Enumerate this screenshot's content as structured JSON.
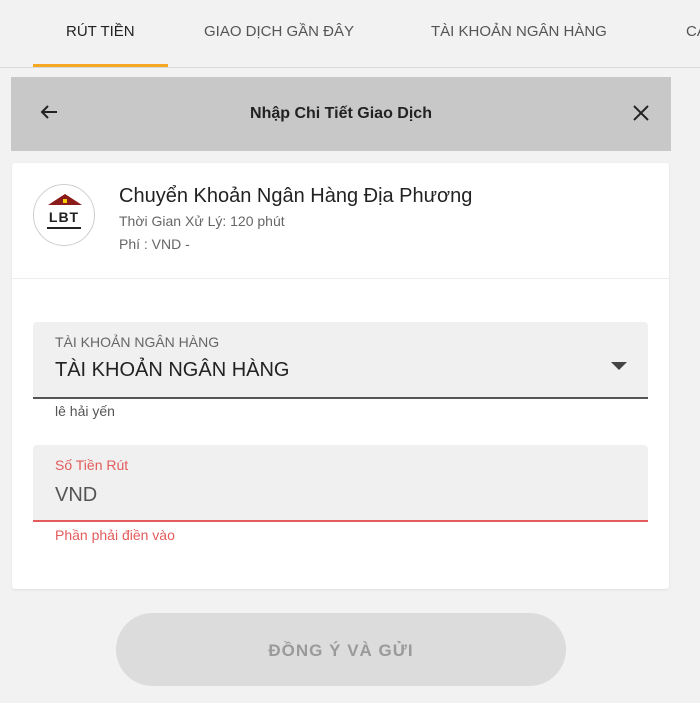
{
  "tabs": [
    {
      "label": "RÚT TIỀN",
      "active": true
    },
    {
      "label": "GIAO DỊCH GẦN ĐÂY",
      "active": false
    },
    {
      "label": "TÀI KHOẢN NGÂN HÀNG",
      "active": false
    },
    {
      "label": "CÀ",
      "active": false
    }
  ],
  "header": {
    "title": "Nhập Chi Tiết Giao Dịch",
    "back_icon": "arrow-left-icon",
    "close_icon": "close-icon"
  },
  "bank": {
    "logo_text": "LBT",
    "name": "Chuyển Khoản Ngân Hàng Địa Phương",
    "processing_time": "Thời Gian Xử Lý: 120 phút",
    "fee": "Phí : VND -"
  },
  "account_field": {
    "label": "TÀI KHOẢN NGÂN HÀNG",
    "value": "TÀI KHOẢN NGÂN HÀNG",
    "helper": "lê hải yến"
  },
  "amount_field": {
    "label": "Số Tiền Rút",
    "value": "VND",
    "error": "Phần phải điền vào"
  },
  "submit": {
    "label": "ĐỒNG Ý VÀ GỬI"
  },
  "colors": {
    "accent": "#f5a623",
    "error": "#e35b5b",
    "header_bg": "#c8c8c8",
    "button_bg": "#dcdcdc"
  }
}
